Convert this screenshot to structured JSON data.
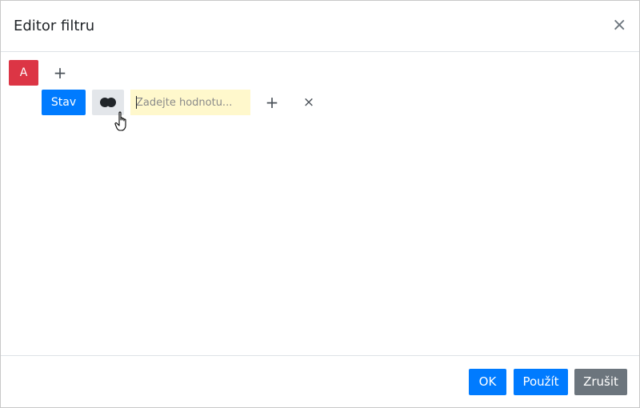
{
  "dialog": {
    "title": "Editor filtru",
    "close_glyph": "×"
  },
  "filter": {
    "group_label": "A",
    "add_condition_glyph": "+",
    "condition": {
      "field_label": "Stav",
      "operator_icon": "two-circles-icon",
      "value": "",
      "value_placeholder": "Zadejte hodnotu...",
      "add_value_glyph": "+",
      "remove_glyph": "×"
    }
  },
  "footer": {
    "ok_label": "OK",
    "apply_label": "Použít",
    "cancel_label": "Zrušit"
  },
  "colors": {
    "group_badge": "#dc3545",
    "primary": "#007bff",
    "secondary": "#6c757d",
    "operator_bg": "#e3e6ea",
    "input_bg": "#fff8cc"
  }
}
